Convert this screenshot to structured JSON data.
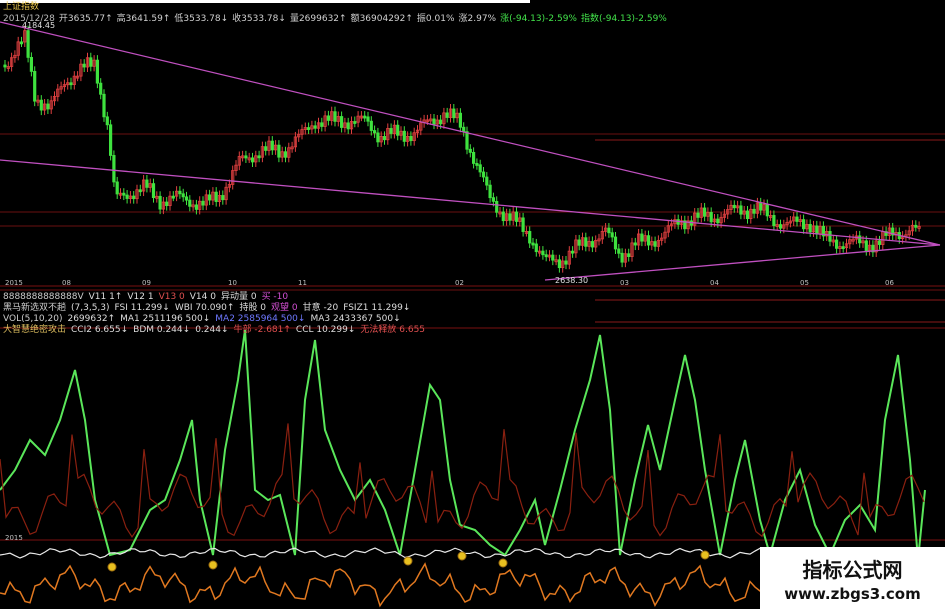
{
  "window": {
    "title": "上证指数"
  },
  "quote_bar": [
    {
      "text": "2015/12/28",
      "color": "#bbbbbb"
    },
    {
      "text": "开3635.77↑",
      "color": "#d0d0d0"
    },
    {
      "text": "高3641.59↑",
      "color": "#d0d0d0"
    },
    {
      "text": "低3533.78↓",
      "color": "#d0d0d0"
    },
    {
      "text": "收3533.78↓",
      "color": "#d0d0d0"
    },
    {
      "text": "量2699632↑",
      "color": "#d0d0d0"
    },
    {
      "text": "额36904292↑",
      "color": "#d0d0d0"
    },
    {
      "text": "振0.01%",
      "color": "#d0d0d0"
    },
    {
      "text": "涨2.97%",
      "color": "#d0d0d0"
    },
    {
      "text": "涨(-94.13)-2.59%",
      "color": "#42e24a"
    },
    {
      "text": "指数(-94.13)-2.59%",
      "color": "#42e24a"
    }
  ],
  "price_labels": {
    "high": "4184.45",
    "low": "2638.30"
  },
  "x_axis_labels": [
    "2015",
    "08",
    "09",
    "10",
    "11",
    "02",
    "03",
    "04",
    "05",
    "06"
  ],
  "indicator_rows": [
    [
      {
        "text": "8888888888888V",
        "color": "#cccccc"
      },
      {
        "text": "V11 1↑",
        "color": "#dddddd"
      },
      {
        "text": "V12 1",
        "color": "#dddddd"
      },
      {
        "text": "V13 0",
        "color": "#e05050"
      },
      {
        "text": "V14 0",
        "color": "#dddddd"
      },
      {
        "text": "异动量 0",
        "color": "#dddddd"
      },
      {
        "text": "买 -10",
        "color": "#d24fd2"
      }
    ],
    [
      {
        "text": "黑马新选双不趟",
        "color": "#cccccc"
      },
      {
        "text": "(7,3,5,3)",
        "color": "#dddddd"
      },
      {
        "text": "FSI 11.299↓",
        "color": "#dddddd"
      },
      {
        "text": "WBI 70.090↑",
        "color": "#dddddd"
      },
      {
        "text": "持股 0",
        "color": "#dddddd"
      },
      {
        "text": "观望 0",
        "color": "#d24fd2"
      },
      {
        "text": "甘意 -20",
        "color": "#dddddd"
      },
      {
        "text": "FSIZ1 11.299↓",
        "color": "#dddddd"
      }
    ],
    [
      {
        "text": "VOL(5,10,20)",
        "color": "#cccccc"
      },
      {
        "text": "2699632↑",
        "color": "#dddddd"
      },
      {
        "text": "MA1 2511196 500↓",
        "color": "#dddddd"
      },
      {
        "text": "MA2 2585964 500↓",
        "color": "#6e78ff"
      },
      {
        "text": "MA3 2433367 500↓",
        "color": "#dddddd"
      }
    ],
    [
      {
        "text": "大智慧绝密攻击",
        "color": "#e0c060"
      },
      {
        "text": "CCI2 6.655↓",
        "color": "#dddddd"
      },
      {
        "text": "BDM 0.244↓",
        "color": "#dddddd"
      },
      {
        "text": "0.244↓",
        "color": "#dddddd"
      },
      {
        "text": "牛部 -2.681↑",
        "color": "#e05050"
      },
      {
        "text": "CCL 10.299↓",
        "color": "#dddddd"
      },
      {
        "text": "无法释放 6.655",
        "color": "#e05050"
      }
    ]
  ],
  "watermark": {
    "title": "指标公式网",
    "url": "www.zbgs3.com"
  },
  "colors": {
    "up": "#e04040",
    "down": "#3fe23f",
    "trend": "#c050c0",
    "grid": "#6a1010"
  }
}
